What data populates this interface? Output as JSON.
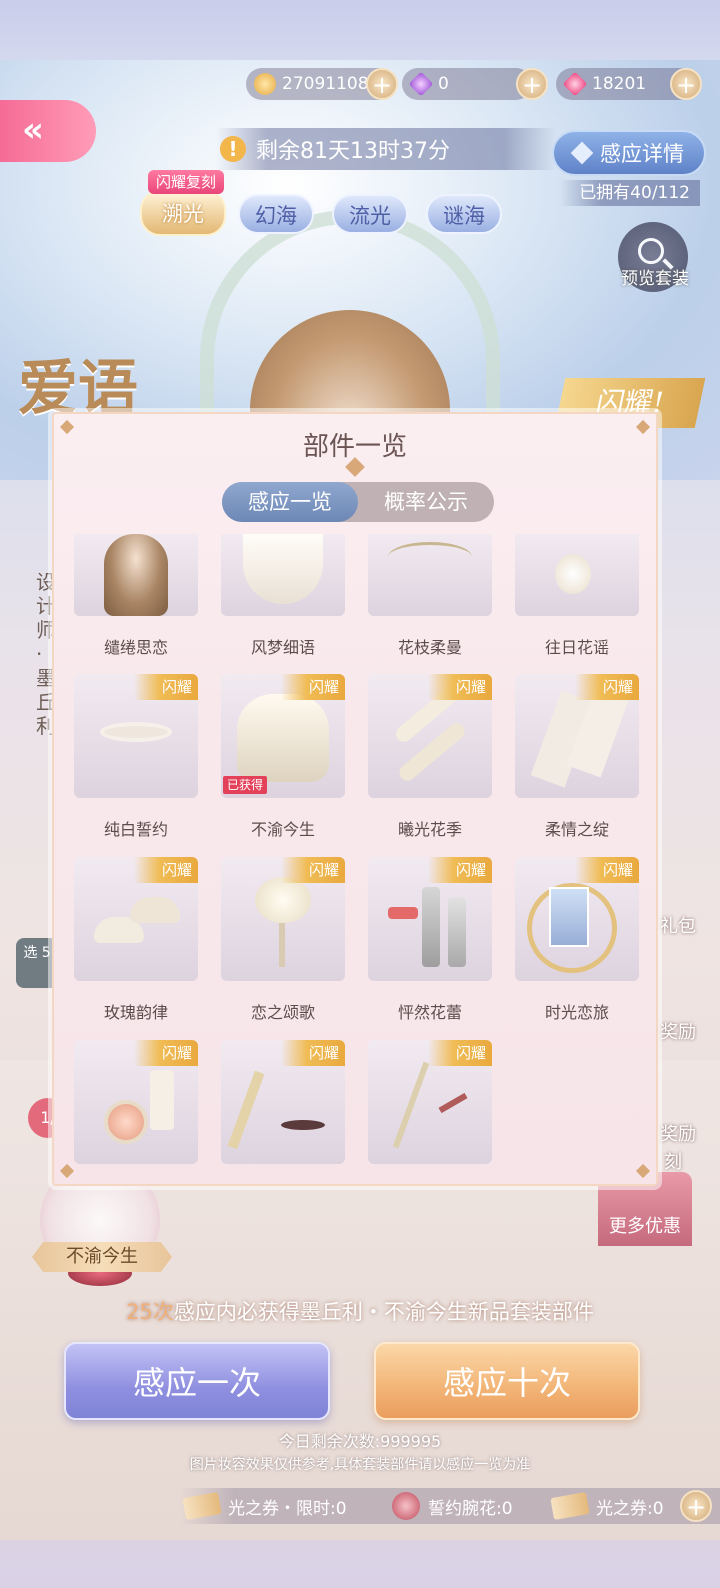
{
  "currency": {
    "gold": "27091108",
    "diamond_purple": "0",
    "diamond_pink": "18201"
  },
  "header": {
    "back_icon": "«",
    "timer": "剩余81天13时37分",
    "detail_button": "感应详情",
    "owned": "已拥有40/112",
    "preview_label": "预览套装"
  },
  "tabs": {
    "badge": "闪耀复刻",
    "items": [
      "溯光",
      "幻海",
      "流光",
      "谜海"
    ]
  },
  "background": {
    "suit_title": "爱语",
    "flash_banner": "闪耀!",
    "designer": "设计师·墨丘利",
    "side_box": "选 5",
    "side_num": "1/",
    "side_labels": [
      "礼包",
      "奖励",
      "奖励",
      "刻"
    ],
    "more_offers": "更多优惠",
    "current_suit": "不渝今生"
  },
  "modal": {
    "title": "部件一览",
    "segments": [
      "感应一览",
      "概率公示"
    ],
    "flash_tag": "闪耀",
    "obtained_tag": "已获得",
    "items": [
      {
        "name": "缱绻思恋",
        "flash": false,
        "obtained": false
      },
      {
        "name": "风梦细语",
        "flash": false,
        "obtained": false
      },
      {
        "name": "花枝柔曼",
        "flash": false,
        "obtained": false
      },
      {
        "name": "往日花谣",
        "flash": false,
        "obtained": false
      },
      {
        "name": "纯白誓约",
        "flash": true,
        "obtained": false
      },
      {
        "name": "不渝今生",
        "flash": true,
        "obtained": true
      },
      {
        "name": "曦光花季",
        "flash": true,
        "obtained": false
      },
      {
        "name": "柔情之绽",
        "flash": true,
        "obtained": false
      },
      {
        "name": "玫瑰韵律",
        "flash": true,
        "obtained": false
      },
      {
        "name": "恋之颂歌",
        "flash": true,
        "obtained": false
      },
      {
        "name": "怦然花蕾",
        "flash": true,
        "obtained": false
      },
      {
        "name": "时光恋旅",
        "flash": true,
        "obtained": false
      },
      {
        "name": "",
        "flash": true,
        "obtained": false
      },
      {
        "name": "",
        "flash": true,
        "obtained": false
      },
      {
        "name": "",
        "flash": true,
        "obtained": false
      }
    ]
  },
  "bottom": {
    "guarantee_num": "25次",
    "guarantee_text": "感应内必获得墨丘利・不渝今生新品套装部件",
    "once_button": "感应一次",
    "ten_button": "感应十次",
    "remain": "今日剩余次数:999995",
    "disclaimer": "图片妆容效果仅供参考,具体套装部件请以感应一览为准",
    "tickets": [
      "光之券・限时:0",
      "誓约腕花:0",
      "光之券:0"
    ]
  },
  "colors": {
    "primary_pink": "#f56b95",
    "accent_gold": "#f0bc55",
    "button_purple": "#8f8fe0",
    "button_orange": "#f2b476"
  }
}
